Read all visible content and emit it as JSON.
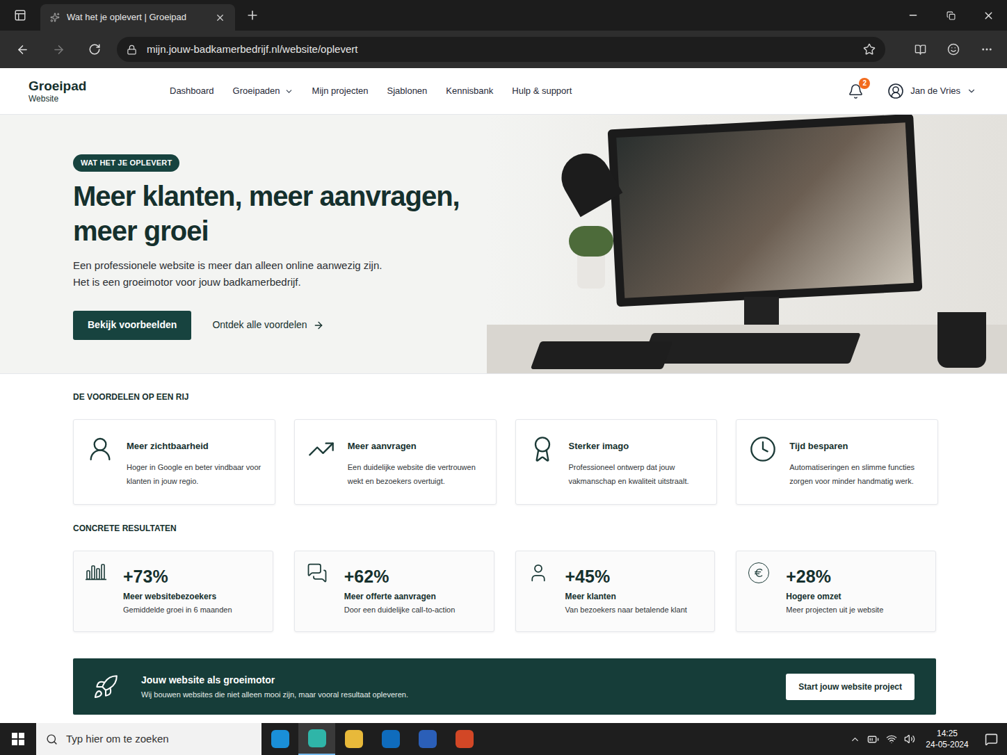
{
  "window": {
    "tab_title": "Wat het je oplevert | Groeipad",
    "url": "mijn.jouw-badkamerbedrijf.nl/website/oplevert"
  },
  "header": {
    "logo": "Groeipad",
    "logo_sub": "Website",
    "nav": [
      {
        "label": "Dashboard",
        "dropdown": false
      },
      {
        "label": "Groeipaden",
        "dropdown": true
      },
      {
        "label": "Mijn projecten",
        "dropdown": false
      },
      {
        "label": "Sjablonen",
        "dropdown": false
      },
      {
        "label": "Kennisbank",
        "dropdown": false
      },
      {
        "label": "Hulp & support",
        "dropdown": false
      }
    ],
    "notifications": "2",
    "user": "Jan de Vries"
  },
  "hero": {
    "badge": "WAT HET JE OPLEVERT",
    "title": "Meer klanten, meer aanvragen, meer groei",
    "lines": [
      "Een professionele website is meer dan alleen online aanwezig zijn.",
      "Het is een groeimotor voor jouw badkamerbedrijf."
    ],
    "primary_button": "Bekijk voorbeelden",
    "link": "Ontdek alle voordelen"
  },
  "benefits": {
    "heading": "DE VOORDELEN OP EEN RIJ",
    "items": [
      {
        "title": "Meer zichtbaarheid",
        "text": "Hoger in Google en beter vindbaar voor klanten in jouw regio."
      },
      {
        "title": "Meer aanvragen",
        "text": "Een duidelijke website die vertrouwen wekt en bezoekers overtuigt."
      },
      {
        "title": "Sterker imago",
        "text": "Professioneel ontwerp dat jouw vakmanschap en kwaliteit uitstraalt."
      },
      {
        "title": "Tijd besparen",
        "text": "Automatiseringen en slimme functies zorgen voor minder handmatig werk."
      }
    ]
  },
  "results": {
    "heading": "CONCRETE RESULTATEN",
    "items": [
      {
        "value": "+73%",
        "label": "Meer websitebezoekers",
        "note": "Gemiddelde groei in 6 maanden"
      },
      {
        "value": "+62%",
        "label": "Meer offerte aanvragen",
        "note": "Door een duidelijke call-to-action"
      },
      {
        "value": "+45%",
        "label": "Meer klanten",
        "note": "Van bezoekers naar betalende klant"
      },
      {
        "value": "+28%",
        "label": "Hogere omzet",
        "note": "Meer projecten uit je website"
      }
    ]
  },
  "banner": {
    "title": "Jouw website als groeimotor",
    "text": "Wij bouwen websites die niet alleen mooi zijn, maar vooral resultaat opleveren.",
    "button": "Start jouw website project"
  },
  "taskbar": {
    "search_placeholder": "Typ hier om te zoeken",
    "apps": [
      {
        "color": "#1a8fd8",
        "selected": false
      },
      {
        "color": "#2fb5a8",
        "selected": true
      },
      {
        "color": "#e8b93a",
        "selected": false
      },
      {
        "color": "#0f6cbd",
        "selected": false
      },
      {
        "color": "#2b5fb8",
        "selected": false
      },
      {
        "color": "#d24726",
        "selected": false
      }
    ],
    "time": "14:25",
    "date": "24-05-2024"
  }
}
